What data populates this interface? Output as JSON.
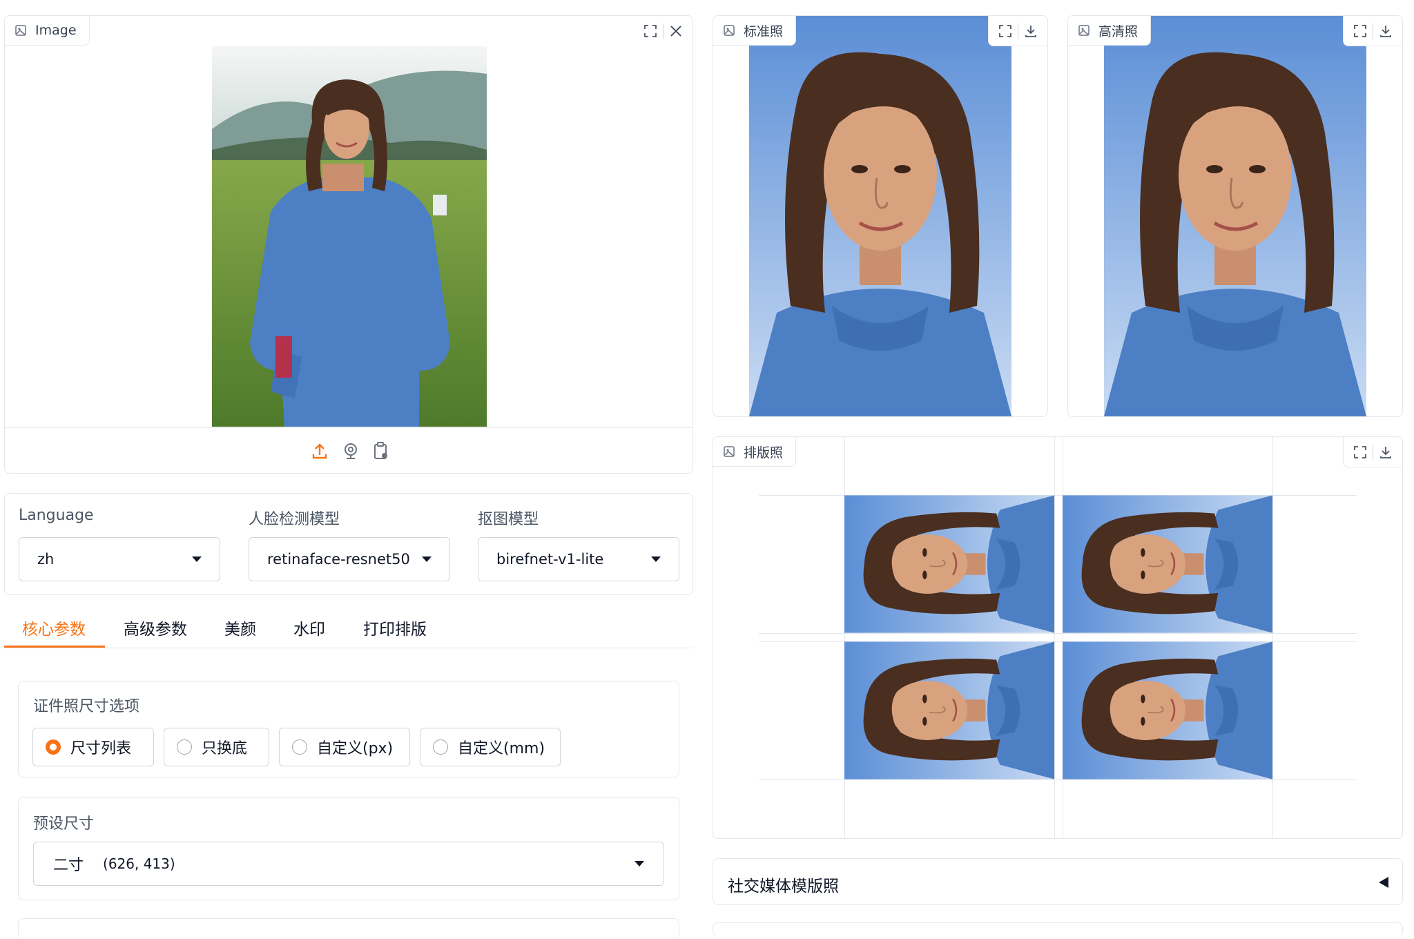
{
  "input_image": {
    "label": "Image",
    "label_icon": "image-icon",
    "actions": {
      "fullscreen_icon": "fullscreen-icon",
      "close_icon": "close-icon"
    },
    "source_buttons": [
      "upload-icon",
      "webcam-icon",
      "clipboard-icon"
    ]
  },
  "outputs": {
    "standard": {
      "label": "标准照"
    },
    "hd": {
      "label": "高清照"
    },
    "layout": {
      "label": "排版照"
    },
    "icons": {
      "fullscreen": "fullscreen-icon",
      "download": "download-icon"
    }
  },
  "settings": {
    "language": {
      "label": "Language",
      "value": "zh"
    },
    "face_model": {
      "label": "人脸检测模型",
      "value": "retinaface-resnet50"
    },
    "matting_model": {
      "label": "抠图模型",
      "value": "birefnet-v1-lite"
    }
  },
  "tabs": [
    {
      "label": "核心参数",
      "active": true
    },
    {
      "label": "高级参数",
      "active": false
    },
    {
      "label": "美颜",
      "active": false
    },
    {
      "label": "水印",
      "active": false
    },
    {
      "label": "打印排版",
      "active": false
    }
  ],
  "size_mode": {
    "label": "证件照尺寸选项",
    "options": [
      "尺寸列表",
      "只换底",
      "自定义(px)",
      "自定义(mm)"
    ],
    "selected": "尺寸列表"
  },
  "preset_size": {
    "label": "预设尺寸",
    "value_name": "二寸",
    "value_dims": "(626, 413)"
  },
  "social_template": {
    "label": "社交媒体模版照",
    "toggle_icon": "collapse-left-icon"
  },
  "colors": {
    "accent": "#f97316",
    "photo_bg_top": "#5b8ed6",
    "photo_bg_bottom": "#c9dbf3",
    "sweater": "#4d7fc4"
  }
}
